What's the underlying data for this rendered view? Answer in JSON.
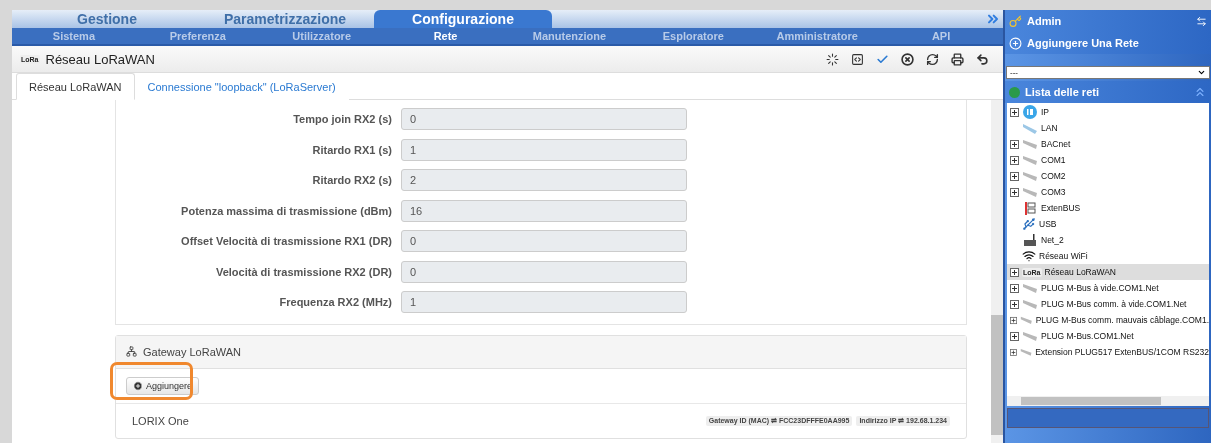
{
  "main_tabs": [
    {
      "label": "Gestione",
      "selected": false
    },
    {
      "label": "Parametrizzazione",
      "selected": false
    },
    {
      "label": "Configurazione",
      "selected": true
    }
  ],
  "sub_menu": [
    {
      "label": "Sistema",
      "selected": false
    },
    {
      "label": "Preferenza",
      "selected": false
    },
    {
      "label": "Utilizzatore",
      "selected": false
    },
    {
      "label": "Rete",
      "selected": true
    },
    {
      "label": "Manutenzione",
      "selected": false
    },
    {
      "label": "Esploratore",
      "selected": false
    },
    {
      "label": "Amministratore",
      "selected": false
    },
    {
      "label": "API",
      "selected": false
    }
  ],
  "page_logo": "LoRa",
  "page_title": "Réseau LoRaWAN",
  "page_tabs": [
    {
      "label": "Réseau LoRaWAN",
      "selected": true
    },
    {
      "label": "Connessione \"loopback\" (LoRaServer)",
      "selected": false
    }
  ],
  "fields": [
    {
      "label": "Tempo join RX2 (s)",
      "value": "0"
    },
    {
      "label": "Ritardo RX1 (s)",
      "value": "1"
    },
    {
      "label": "Ritardo RX2 (s)",
      "value": "2"
    },
    {
      "label": "Potenza massima di trasmissione (dBm)",
      "value": "16"
    },
    {
      "label": "Offset Velocità di trasmissione RX1 (DR)",
      "value": "0"
    },
    {
      "label": "Velocità di trasmissione RX2 (DR)",
      "value": "0"
    },
    {
      "label": "Frequenza RX2 (MHz)",
      "value": "1"
    }
  ],
  "gateway_panel": {
    "title": "Gateway LoRaWAN",
    "add_button": "Aggiungere",
    "highlighted": true,
    "gateways": [
      {
        "name": "LORIX One",
        "tags": [
          "Gateway ID (MAC) ⇌ FCC23DFFFE0AA995",
          "Indirizzo IP ⇌ 192.68.1.234"
        ]
      }
    ]
  },
  "sidebar": {
    "user": "Admin",
    "add_network": {
      "title": "Aggiungere Una Rete",
      "select_value": "---"
    },
    "network_list": {
      "title": "Lista delle reti",
      "items": [
        {
          "label": "IP",
          "kind": "ip",
          "expandable": true,
          "selected": false
        },
        {
          "label": "LAN",
          "kind": "lan",
          "expandable": false,
          "selected": false
        },
        {
          "label": "BACnet",
          "kind": "serial",
          "expandable": true,
          "selected": false
        },
        {
          "label": "COM1",
          "kind": "serial",
          "expandable": true,
          "selected": false
        },
        {
          "label": "COM2",
          "kind": "serial",
          "expandable": true,
          "selected": false
        },
        {
          "label": "COM3",
          "kind": "serial",
          "expandable": true,
          "selected": false
        },
        {
          "label": "ExtenBUS",
          "kind": "bus",
          "expandable": false,
          "selected": false
        },
        {
          "label": "USB",
          "kind": "usb",
          "expandable": false,
          "selected": false
        },
        {
          "label": "Net_2",
          "kind": "router",
          "expandable": false,
          "selected": false
        },
        {
          "label": "Réseau WiFi",
          "kind": "wifi",
          "expandable": false,
          "selected": false
        },
        {
          "label": "Réseau LoRaWAN",
          "kind": "lora",
          "logo": "LoRa",
          "expandable": true,
          "selected": true
        },
        {
          "label": "PLUG M-Bus à vide.COM1.Net",
          "kind": "serial",
          "expandable": true,
          "selected": false
        },
        {
          "label": "PLUG M-Bus comm. à vide.COM1.Net",
          "kind": "serial",
          "expandable": true,
          "selected": false
        },
        {
          "label": "PLUG M-Bus comm. mauvais câblage.COM1.",
          "kind": "serial",
          "expandable": true,
          "selected": false
        },
        {
          "label": "PLUG M-Bus.COM1.Net",
          "kind": "serial",
          "expandable": true,
          "selected": false
        },
        {
          "label": "Extension PLUG517 ExtenBUS/1COM RS232",
          "kind": "serial",
          "expandable": true,
          "selected": false
        }
      ]
    }
  }
}
